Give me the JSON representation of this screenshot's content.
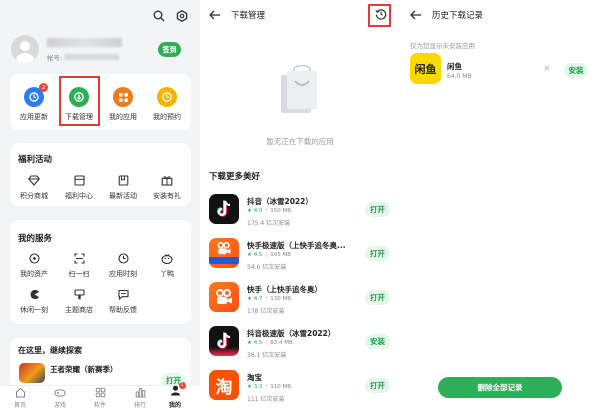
{
  "colors": {
    "accent": "#2fae5a",
    "red_highlight": "#e53935",
    "badge": "#f04438"
  },
  "panel1": {
    "profile": {
      "account_prefix": "帐号:",
      "signin_label": "签到"
    },
    "quick": [
      {
        "label": "应用更新",
        "icon": "update-icon",
        "badge": "2",
        "color": "#2c7cf6"
      },
      {
        "label": "下载管理",
        "icon": "download-icon",
        "color": "#2fae5a"
      },
      {
        "label": "我的应用",
        "icon": "grid-icon",
        "color": "#f07a1b"
      },
      {
        "label": "我的预约",
        "icon": "clock-icon",
        "color": "#f5b400"
      }
    ],
    "welfare": {
      "title": "福利活动",
      "items": [
        {
          "label": "积分商城",
          "icon": "diamond-icon"
        },
        {
          "label": "福利中心",
          "icon": "package-icon"
        },
        {
          "label": "最新活动",
          "icon": "bookmark-icon"
        },
        {
          "label": "安装有礼",
          "icon": "gift-icon"
        }
      ]
    },
    "services": {
      "title": "我的服务",
      "items": [
        {
          "label": "我的资产",
          "icon": "coin-icon"
        },
        {
          "label": "扫一扫",
          "icon": "scan-icon"
        },
        {
          "label": "应用时刻",
          "icon": "clock-icon"
        },
        {
          "label": "丫鸭",
          "icon": "duck-icon"
        },
        {
          "label": "休闲一刻",
          "icon": "pacman-icon"
        },
        {
          "label": "主题商店",
          "icon": "brush-icon"
        },
        {
          "label": "帮助反馈",
          "icon": "chat-icon"
        }
      ]
    },
    "explore": {
      "title": "在这里，继续探索",
      "app_name": "王者荣耀（新赛季）",
      "open_label": "打开"
    },
    "tabs": [
      {
        "label": "首页",
        "icon": "home-icon"
      },
      {
        "label": "游戏",
        "icon": "gamepad-icon"
      },
      {
        "label": "软件",
        "icon": "apps-icon"
      },
      {
        "label": "排行",
        "icon": "ranking-icon"
      },
      {
        "label": "我的",
        "icon": "person-icon",
        "badge": "1",
        "active": true
      }
    ]
  },
  "panel2": {
    "title": "下载管理",
    "empty_text": "暂无正在下载的应用",
    "section_title": "下载更多美好",
    "apps": [
      {
        "name": "抖音（冰雪2022）",
        "rating": "4.0",
        "size": "150 MB",
        "downloads": "175.4 亿次安装",
        "button": "打开",
        "icon": "douyin"
      },
      {
        "name": "快手极速版（上快手追冬奥...",
        "rating": "4.5",
        "size": "105 MB",
        "downloads": "54.6 亿次安装",
        "button": "打开",
        "icon": "kuaishou-lite"
      },
      {
        "name": "快手（上快手追冬奥）",
        "rating": "4.7",
        "size": "130 MB",
        "downloads": "178 亿次安装",
        "button": "打开",
        "icon": "kuaishou"
      },
      {
        "name": "抖音极速版（冰雪2022）",
        "rating": "4.5",
        "size": "83.4 MB",
        "downloads": "36.1 亿次安装",
        "button": "安装",
        "icon": "douyin-lite"
      },
      {
        "name": "淘宝",
        "rating": "3.3",
        "size": "110 MB",
        "downloads": "111 亿次安装",
        "button": "打开",
        "icon": "taobao"
      }
    ]
  },
  "panel3": {
    "title": "历史下载记录",
    "subtitle": "仅为您显示未安装应用",
    "item": {
      "name": "闲鱼",
      "size": "64.0 MB",
      "button": "安装",
      "close": "×",
      "icon_text": "闲鱼"
    },
    "delete_all": "删除全部记录"
  }
}
